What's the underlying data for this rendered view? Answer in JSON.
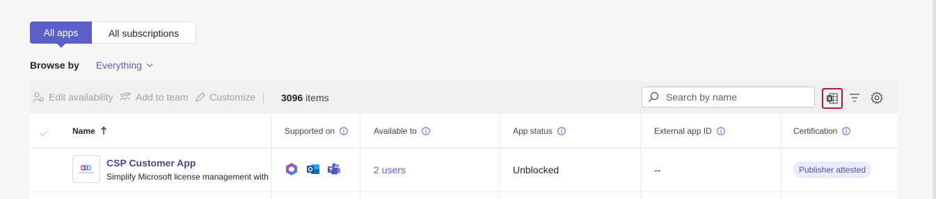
{
  "tabs": [
    {
      "label": "All apps",
      "active": true
    },
    {
      "label": "All subscriptions",
      "active": false
    }
  ],
  "browse": {
    "label": "Browse by",
    "value": "Everything"
  },
  "toolbar": {
    "edit_availability": "Edit availability",
    "add_to_team": "Add to team",
    "customize": "Customize",
    "count_number": "3096",
    "count_suffix": "items",
    "search_placeholder": "Search by name"
  },
  "table": {
    "headers": {
      "name": "Name",
      "supported_on": "Supported on",
      "available_to": "Available to",
      "app_status": "App status",
      "external_app_id": "External app ID",
      "certification": "Certification"
    },
    "rows": [
      {
        "name": "CSP Customer App",
        "description": "Simplify Microsoft license management with",
        "platforms": [
          "m365-icon",
          "outlook-icon",
          "teams-icon"
        ],
        "available_to": "2 users",
        "status": "Unblocked",
        "external_id": "--",
        "certification": "Publisher attested"
      }
    ]
  },
  "colors": {
    "accent": "#5b5fc7",
    "highlight_border": "#b31b2f",
    "badge_bg": "#e8ebfa"
  }
}
